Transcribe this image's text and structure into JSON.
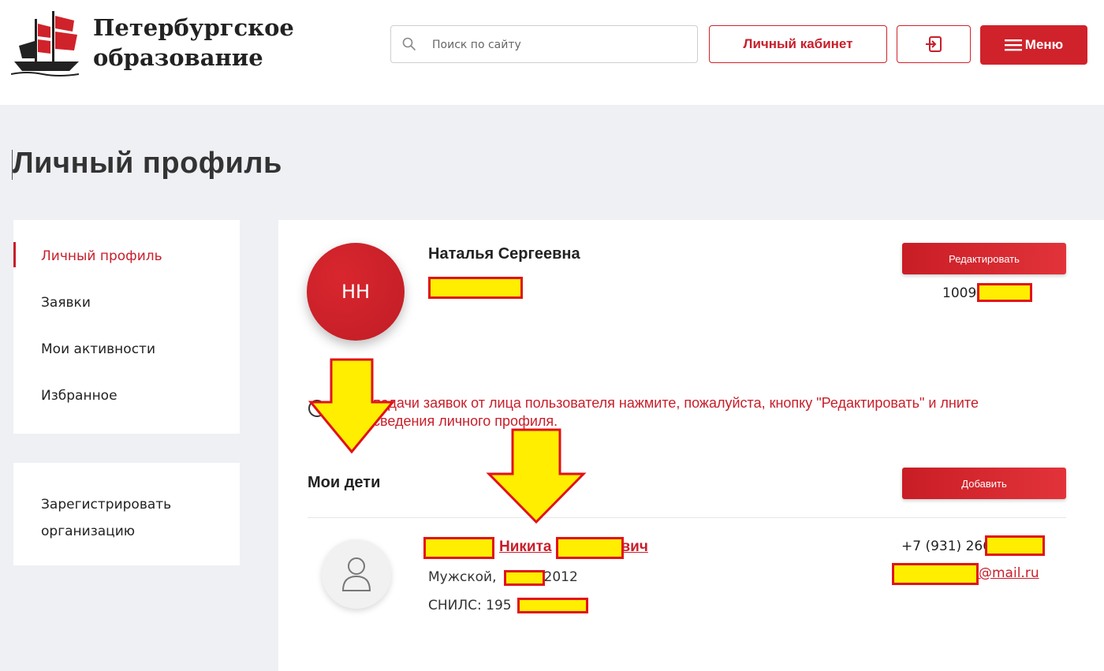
{
  "header": {
    "logo_line1": "Петербургское",
    "logo_line2": "образование",
    "search_placeholder": "Поиск по сайту",
    "cabinet_label": "Личный кабинет",
    "menu_label": "Меню"
  },
  "page": {
    "title": "Личный профиль"
  },
  "sidebar": {
    "items": [
      {
        "label": "Личный профиль",
        "active": true
      },
      {
        "label": "Заявки"
      },
      {
        "label": "Мои активности"
      },
      {
        "label": "Избранное"
      }
    ],
    "register_label": "Зарегистрировать организацию"
  },
  "profile": {
    "initials": "НН",
    "name": "Наталья Сергеевна",
    "edit_label": "Редактировать",
    "id_prefix": "1009",
    "warning": "подачи заявок от лица пользователя нажмите, пожалуйста, кнопку \"Редактировать\" и лните сведения личного профиля."
  },
  "children": {
    "title": "Мои дети",
    "add_label": "Добавить",
    "child": {
      "name_visible": "Никита",
      "name_tail": "вич",
      "gender": "Мужской,",
      "birth_year": "2012",
      "snils_prefix": "СНИЛС: 195",
      "phone": "+7 (931) 266",
      "email_suffix": "@mail.ru"
    }
  },
  "colors": {
    "brand_red": "#d0222a",
    "redaction_fill": "#ffee00"
  }
}
